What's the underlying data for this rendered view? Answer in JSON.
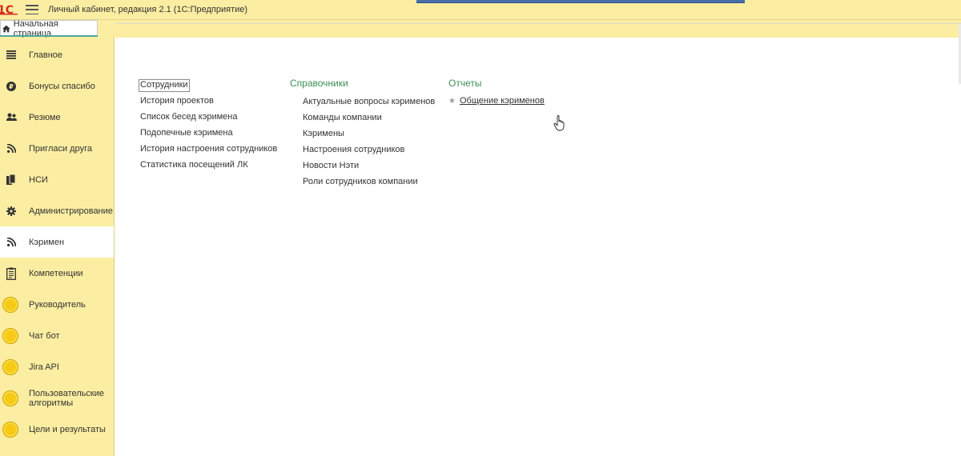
{
  "window": {
    "logo_text": "1С",
    "title": "Личный кабинет, редакция 2.1  (1С:Предприятие)"
  },
  "home_tab": {
    "label": "Начальная страница"
  },
  "sidebar": {
    "items": [
      {
        "label": "Главное",
        "icon": "menu-lines-icon",
        "active": false
      },
      {
        "label": "Бонусы спасибо",
        "icon": "ruble-coin-icon",
        "active": false
      },
      {
        "label": "Резюме",
        "icon": "users-icon",
        "active": false
      },
      {
        "label": "Пригласи друга",
        "icon": "rss-icon",
        "active": false
      },
      {
        "label": "НСИ",
        "icon": "documents-icon",
        "active": false
      },
      {
        "label": "Администрирование",
        "icon": "gear-icon",
        "active": false
      },
      {
        "label": "Кэримен",
        "icon": "rss-icon",
        "active": true
      },
      {
        "label": "Компетенции",
        "icon": "clipboard-icon",
        "active": false
      },
      {
        "label": "Руководитель",
        "icon": "coin-icon",
        "active": false
      },
      {
        "label": "Чат бот",
        "icon": "coin-icon",
        "active": false
      },
      {
        "label": "Jira API",
        "icon": "coin-icon",
        "active": false
      },
      {
        "label": "Пользовательские алгоритмы",
        "icon": "coin-icon",
        "active": false
      },
      {
        "label": "Цели и результаты",
        "icon": "coin-icon",
        "active": false
      }
    ]
  },
  "main": {
    "col1": {
      "items": [
        "Сотрудники",
        "История проектов",
        "Список бесед кэримена",
        "Подопечные кэримена",
        "История настроения сотрудников",
        "Статистика посещений ЛК"
      ]
    },
    "col2": {
      "heading": "Справочники",
      "items": [
        "Актуальные вопросы кэрименов",
        "Команды компании",
        "Кэримены",
        "Настроения сотрудников",
        "Новости Нэти",
        "Роли сотрудников компании"
      ]
    },
    "col3": {
      "heading": "Отчеты",
      "items": [
        "Общение кэрименов"
      ]
    }
  },
  "colors": {
    "sidebar_bg": "#fbeda1",
    "heading_green": "#3c8f55",
    "coin_yellow": "#f6c915",
    "accent_blue": "#4a6ea9"
  }
}
